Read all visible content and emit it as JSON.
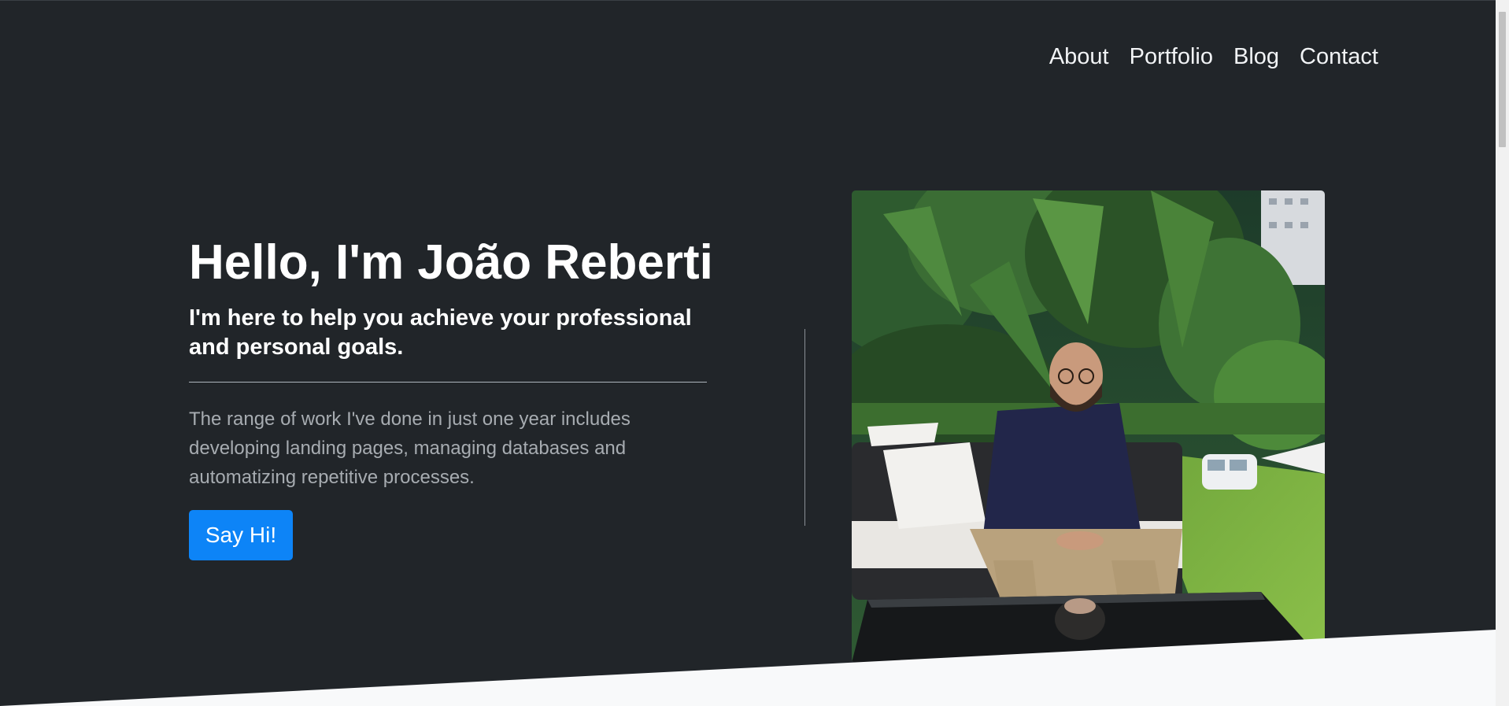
{
  "nav": {
    "items": [
      "About",
      "Portfolio",
      "Blog",
      "Contact"
    ]
  },
  "hero": {
    "headline": "Hello, I'm João Reberti",
    "subhead": "I'm here to help you achieve your professional and personal goals.",
    "description": "The range of work I've done in just one year includes developing landing pages, managing databases and automatizing repetitive processes.",
    "cta_label": "Say Hi!"
  },
  "colors": {
    "hero_background": "#212529",
    "accent": "#0d84f7",
    "section_background": "#f8f9fa"
  },
  "photo": {
    "icon": "portrait-photo"
  }
}
